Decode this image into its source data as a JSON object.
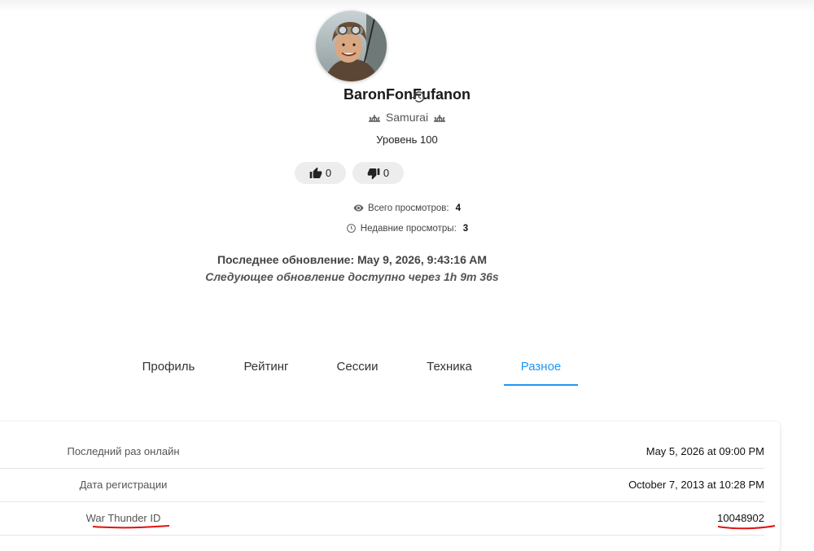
{
  "profile": {
    "username": "BaronFonFufanon",
    "title": "Samurai",
    "level": "Уровень 100",
    "likes": "0",
    "dislikes": "0"
  },
  "stats": {
    "views_label": "Всего просмотров:",
    "views_value": "4",
    "recent_label": "Недавние просмотры:",
    "recent_value": "3"
  },
  "update": {
    "last": "Последнее обновление: May 9, 2026, 9:43:16 AM",
    "next": "Следующее обновление доступно через 1h 9m 36s"
  },
  "tabs": [
    {
      "label": "Профиль"
    },
    {
      "label": "Рейтинг"
    },
    {
      "label": "Сессии"
    },
    {
      "label": "Техника"
    },
    {
      "label": "Разное",
      "active": true
    }
  ],
  "info": [
    {
      "label": "Последний раз онлайн",
      "value": "May 5, 2026 at 09:00 PM"
    },
    {
      "label": "Дата регистрации",
      "value": "October 7, 2013 at 10:28 PM"
    },
    {
      "label": "War Thunder ID",
      "value": "10048902"
    }
  ],
  "colors": {
    "accent": "#2196f3",
    "annotation": "#e01010",
    "vote_bg": "#ededed"
  },
  "icons": {
    "history": "history-icon",
    "title_ornament": "samurai-ornament-icon",
    "like": "thumbs-up-icon",
    "dislike": "thumbs-down-icon",
    "views": "eye-icon",
    "recent": "clock-icon"
  }
}
